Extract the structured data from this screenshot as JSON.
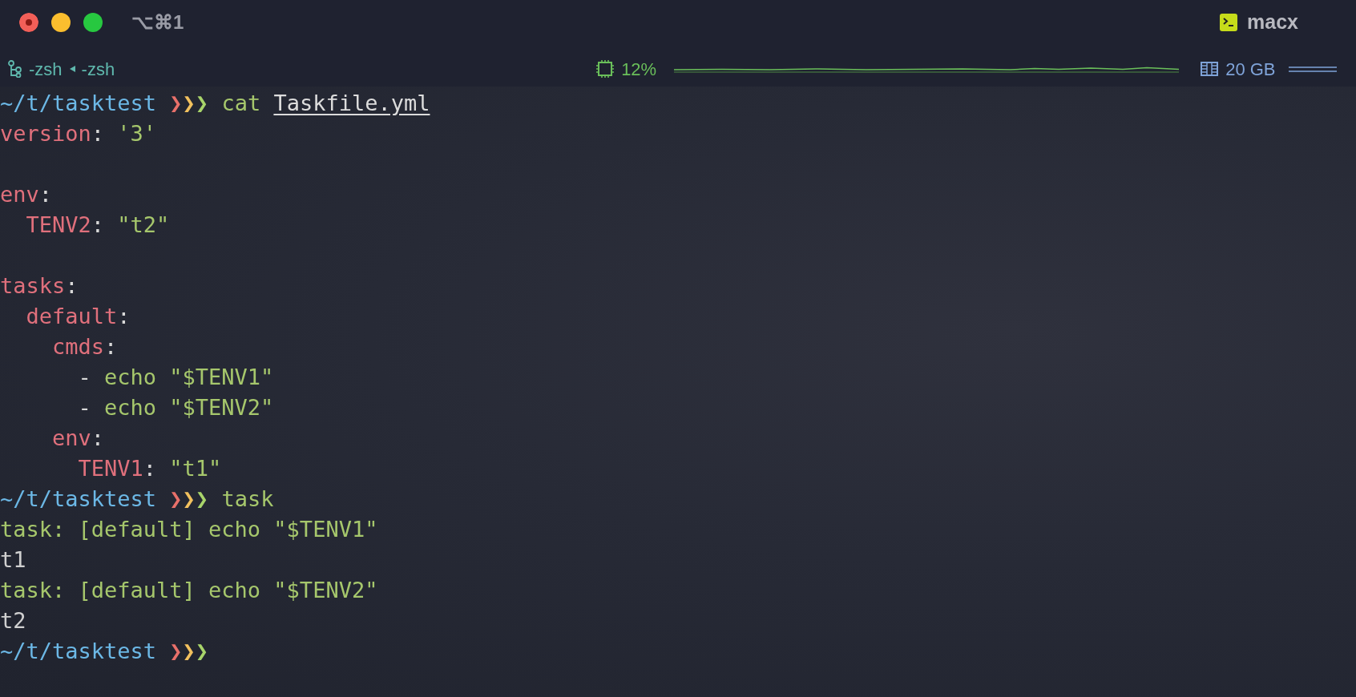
{
  "window": {
    "title": "⌥⌘1",
    "session": "macx"
  },
  "status_bar": {
    "shell": "-zsh",
    "parent_shell": "-zsh",
    "cpu": "12%",
    "memory": "20 GB"
  },
  "terminal": {
    "lines": [
      {
        "kind": "text",
        "segments": [
          {
            "kind": "path",
            "text": "~/t/tasktest "
          },
          {
            "kind": "chev_a",
            "text": "❯"
          },
          {
            "kind": "chev_b",
            "text": "❯"
          },
          {
            "kind": "chev_c",
            "text": "❯"
          },
          {
            "kind": "command",
            "text": " cat "
          },
          {
            "kind": "arg",
            "text": "Taskfile.yml"
          }
        ]
      },
      {
        "kind": "text",
        "segments": [
          {
            "kind": "key",
            "text": "version"
          },
          {
            "kind": "punct",
            "text": ": "
          },
          {
            "kind": "string",
            "text": "'3'"
          }
        ]
      },
      {
        "kind": "blank"
      },
      {
        "kind": "text",
        "segments": [
          {
            "kind": "key",
            "text": "env"
          },
          {
            "kind": "punct",
            "text": ":"
          }
        ]
      },
      {
        "kind": "text",
        "segments": [
          {
            "kind": "key",
            "text": "  TENV2"
          },
          {
            "kind": "punct",
            "text": ": "
          },
          {
            "kind": "string",
            "text": "\"t2\""
          }
        ]
      },
      {
        "kind": "blank"
      },
      {
        "kind": "text",
        "segments": [
          {
            "kind": "key",
            "text": "tasks"
          },
          {
            "kind": "punct",
            "text": ":"
          }
        ]
      },
      {
        "kind": "text",
        "segments": [
          {
            "kind": "key",
            "text": "  default"
          },
          {
            "kind": "punct",
            "text": ":"
          }
        ]
      },
      {
        "kind": "text",
        "segments": [
          {
            "kind": "key",
            "text": "    cmds"
          },
          {
            "kind": "punct",
            "text": ":"
          }
        ]
      },
      {
        "kind": "text",
        "segments": [
          {
            "kind": "punct",
            "text": "      - "
          },
          {
            "kind": "string",
            "text": "echo \"$TENV1\""
          }
        ]
      },
      {
        "kind": "text",
        "segments": [
          {
            "kind": "punct",
            "text": "      - "
          },
          {
            "kind": "string",
            "text": "echo \"$TENV2\""
          }
        ]
      },
      {
        "kind": "text",
        "segments": [
          {
            "kind": "key",
            "text": "    env"
          },
          {
            "kind": "punct",
            "text": ":"
          }
        ]
      },
      {
        "kind": "text",
        "segments": [
          {
            "kind": "key",
            "text": "      TENV1"
          },
          {
            "kind": "punct",
            "text": ": "
          },
          {
            "kind": "string",
            "text": "\"t1\""
          }
        ]
      },
      {
        "kind": "text",
        "segments": [
          {
            "kind": "path",
            "text": "~/t/tasktest "
          },
          {
            "kind": "chev_a",
            "text": "❯"
          },
          {
            "kind": "chev_b",
            "text": "❯"
          },
          {
            "kind": "chev_c",
            "text": "❯"
          },
          {
            "kind": "command",
            "text": " task"
          }
        ]
      },
      {
        "kind": "text",
        "segments": [
          {
            "kind": "string",
            "text": "task: [default] echo \"$TENV1\""
          }
        ]
      },
      {
        "kind": "text",
        "segments": [
          {
            "kind": "output",
            "text": "t1"
          }
        ]
      },
      {
        "kind": "text",
        "segments": [
          {
            "kind": "string",
            "text": "task: [default] echo \"$TENV2\""
          }
        ]
      },
      {
        "kind": "text",
        "segments": [
          {
            "kind": "output",
            "text": "t2"
          }
        ]
      },
      {
        "kind": "text",
        "segments": [
          {
            "kind": "path",
            "text": "~/t/tasktest "
          },
          {
            "kind": "chev_a",
            "text": "❯"
          },
          {
            "kind": "chev_b",
            "text": "❯"
          },
          {
            "kind": "chev_c",
            "text": "❯"
          }
        ]
      }
    ]
  }
}
